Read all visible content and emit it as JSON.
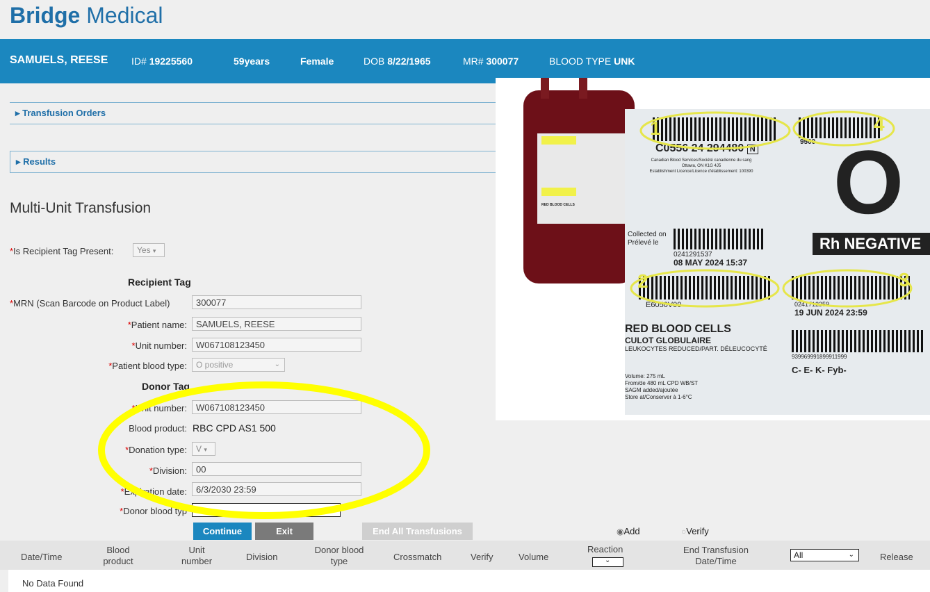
{
  "brand": {
    "part1": "Bridge",
    "part2": " Medical"
  },
  "patient": {
    "name": "SAMUELS, REESE",
    "id_label": "ID#",
    "id": "19225560",
    "age": "59years",
    "sex": "Female",
    "dob_label": "DOB",
    "dob": "8/22/1965",
    "mr_label": "MR#",
    "mr": "300077",
    "bt_label": "BLOOD TYPE",
    "bt": "UNK"
  },
  "sections": {
    "orders": "▸ Transfusion Orders",
    "results": "▸ Results"
  },
  "page_title": "Multi-Unit Transfusion",
  "form": {
    "recipient_tag_present_label": "Is Recipient Tag Present:",
    "recipient_tag_present_value": "Yes",
    "recipient_heading": "Recipient Tag",
    "mrn_label": "MRN (Scan Barcode on Product Label)",
    "mrn": "300077",
    "patient_name_label": "Patient name:",
    "patient_name": "SAMUELS, REESE",
    "unit_number_label": "Unit number:",
    "unit_number": "W067108123450",
    "patient_blood_type_label": "Patient blood type:",
    "patient_blood_type": "O positive",
    "donor_heading": "Donor Tag",
    "donor_unit_label": "Unit number:",
    "donor_unit": "W067108123450",
    "blood_product_label": "Blood product:",
    "blood_product": "RBC CPD AS1 500",
    "donation_type_label": "Donation type:",
    "donation_type": "V",
    "division_label": "Division:",
    "division": "00",
    "expiration_label": "Expiration date:",
    "expiration": "6/3/2030 23:59",
    "donor_blood_type_label": "Donor blood typ"
  },
  "buttons": {
    "continue": "Continue",
    "exit": "Exit",
    "end_all": "End All Transfusions"
  },
  "radios": {
    "add": "Add",
    "verify": "Verify"
  },
  "table": {
    "headers": [
      "Date/Time",
      "Blood product",
      "Unit number",
      "Division",
      "Donor blood type",
      "Crossmatch",
      "Verify",
      "Volume",
      "Reaction",
      "End Transfusion Date/Time",
      "",
      "Release"
    ],
    "filter": "All",
    "empty": "No Data Found"
  },
  "label_photo": {
    "bag_label": "RED BLOOD CELLS",
    "code1": "C0556 24 294480",
    "flag": "N",
    "code4": "9500",
    "blood_group": "O",
    "rh": "Rh NEGATIVE",
    "issuer": "Canadian Blood Services/Société canadienne du sang",
    "city": "Ottawa, ON K1G 4J5",
    "licence": "Establishment Licence/Licence d'établissement: 100390",
    "collected": "Collected on",
    "collected_fr": "Prélevé le",
    "collected_code": "0241291537",
    "collected_date": "08 MAY 2024  15:37",
    "code2": "E6050V00",
    "code3": "0241712359",
    "exp_date": "19 JUN 2024  23:59",
    "product": "RED BLOOD CELLS",
    "product_fr": "CULOT GLOBULAIRE",
    "product_sub": "LEUKOCYTES REDUCED/PART. DÉLEUCOCYTÉ",
    "serial": "939969991899911999",
    "antigens": "C- E- K- Fyb-",
    "volume": "Volume: 275 mL",
    "source": "From/de 480 mL CPD WB/ST",
    "sagm": "SAGM added/ajoutée",
    "store": "Store at/Conserver à 1-6°C",
    "markers": [
      "1",
      "2",
      "3",
      "4"
    ]
  },
  "colors": {
    "header": "#1b87bf",
    "brand": "#1f6fa8",
    "highlight": "#ffff00",
    "continue": "#1b87bf",
    "exit": "#7a7a7a",
    "end_all": "#cfcfcf"
  }
}
